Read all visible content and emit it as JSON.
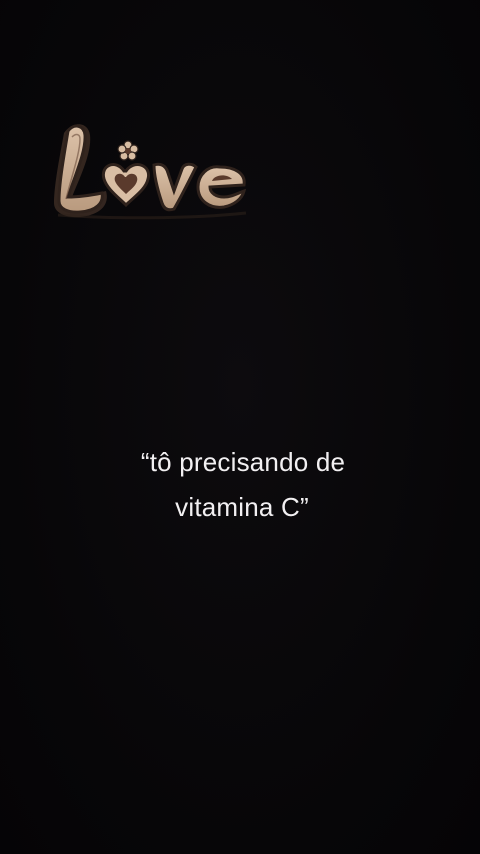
{
  "sticker": {
    "text": "Love",
    "icon": "love-sticker-icon",
    "colors": {
      "fill": "#c8ab90",
      "outline": "#3a2a22",
      "heart": "#5a3a2c"
    }
  },
  "caption": {
    "line1": "“tô precisando de",
    "line2": "vitamina C”",
    "color": "#f2f0f2"
  },
  "background": {
    "color": "#070608"
  }
}
